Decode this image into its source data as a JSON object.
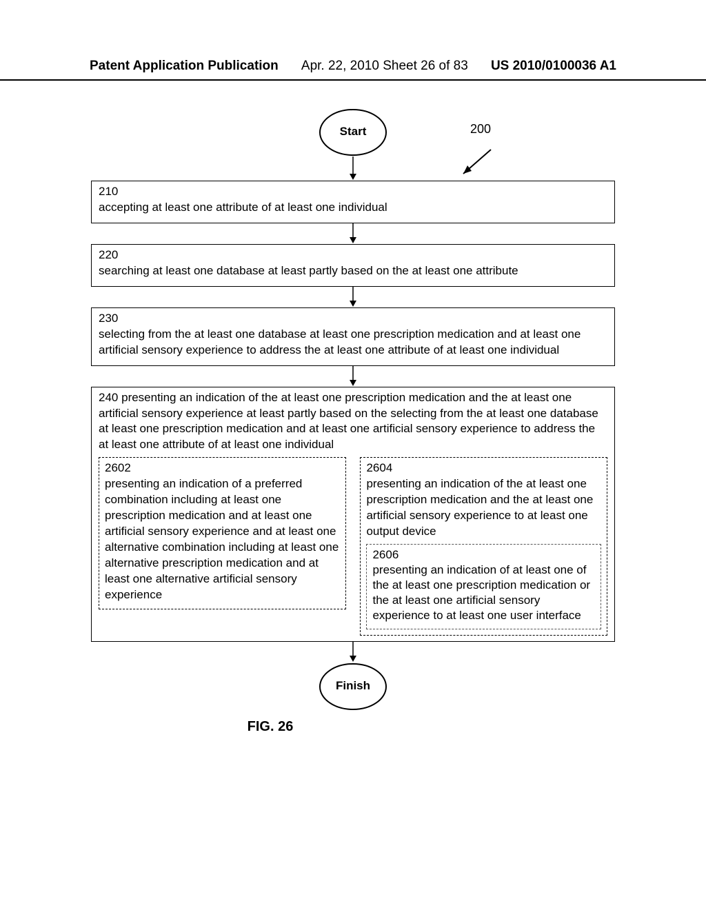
{
  "header": {
    "publication": "Patent Application Publication",
    "date_sheet": "Apr. 22, 2010  Sheet 26 of 83",
    "pub_number": "US 2010/0100036 A1"
  },
  "diagram": {
    "ref_number": "200",
    "start_label": "Start",
    "finish_label": "Finish",
    "figure_label": "FIG. 26",
    "steps": {
      "s210": {
        "num": "210",
        "text": "accepting at least one attribute of at least one individual"
      },
      "s220": {
        "num": "220",
        "text": "searching at least one database at least partly based on the at least one attribute"
      },
      "s230": {
        "num": "230",
        "text": "selecting from the at least one database at least one prescription medication and at least one artificial sensory experience to address the at least one attribute of at least one individual"
      },
      "s240": {
        "num": "240",
        "text": "presenting an indication of the at least one prescription medication and the at least one artificial sensory experience at least partly based on the selecting from the at least one database at least one prescription medication and at least one artificial sensory experience to address the at least one attribute of at least one individual"
      }
    },
    "subs": {
      "s2602": {
        "num": "2602",
        "text": "presenting an indication of a preferred combination including at least one prescription medication and at least one artificial sensory experience and at least one alternative combination including at least one alternative prescription medication and at least one alternative artificial sensory experience"
      },
      "s2604": {
        "num": "2604",
        "text": "presenting an indication of the at least one prescription medication and the at least one artificial sensory experience to at least one output device"
      },
      "s2606": {
        "num": "2606",
        "text": "presenting an indication of at least one of the at least one prescription medication or the at least one artificial sensory experience to at least one user interface"
      }
    }
  }
}
